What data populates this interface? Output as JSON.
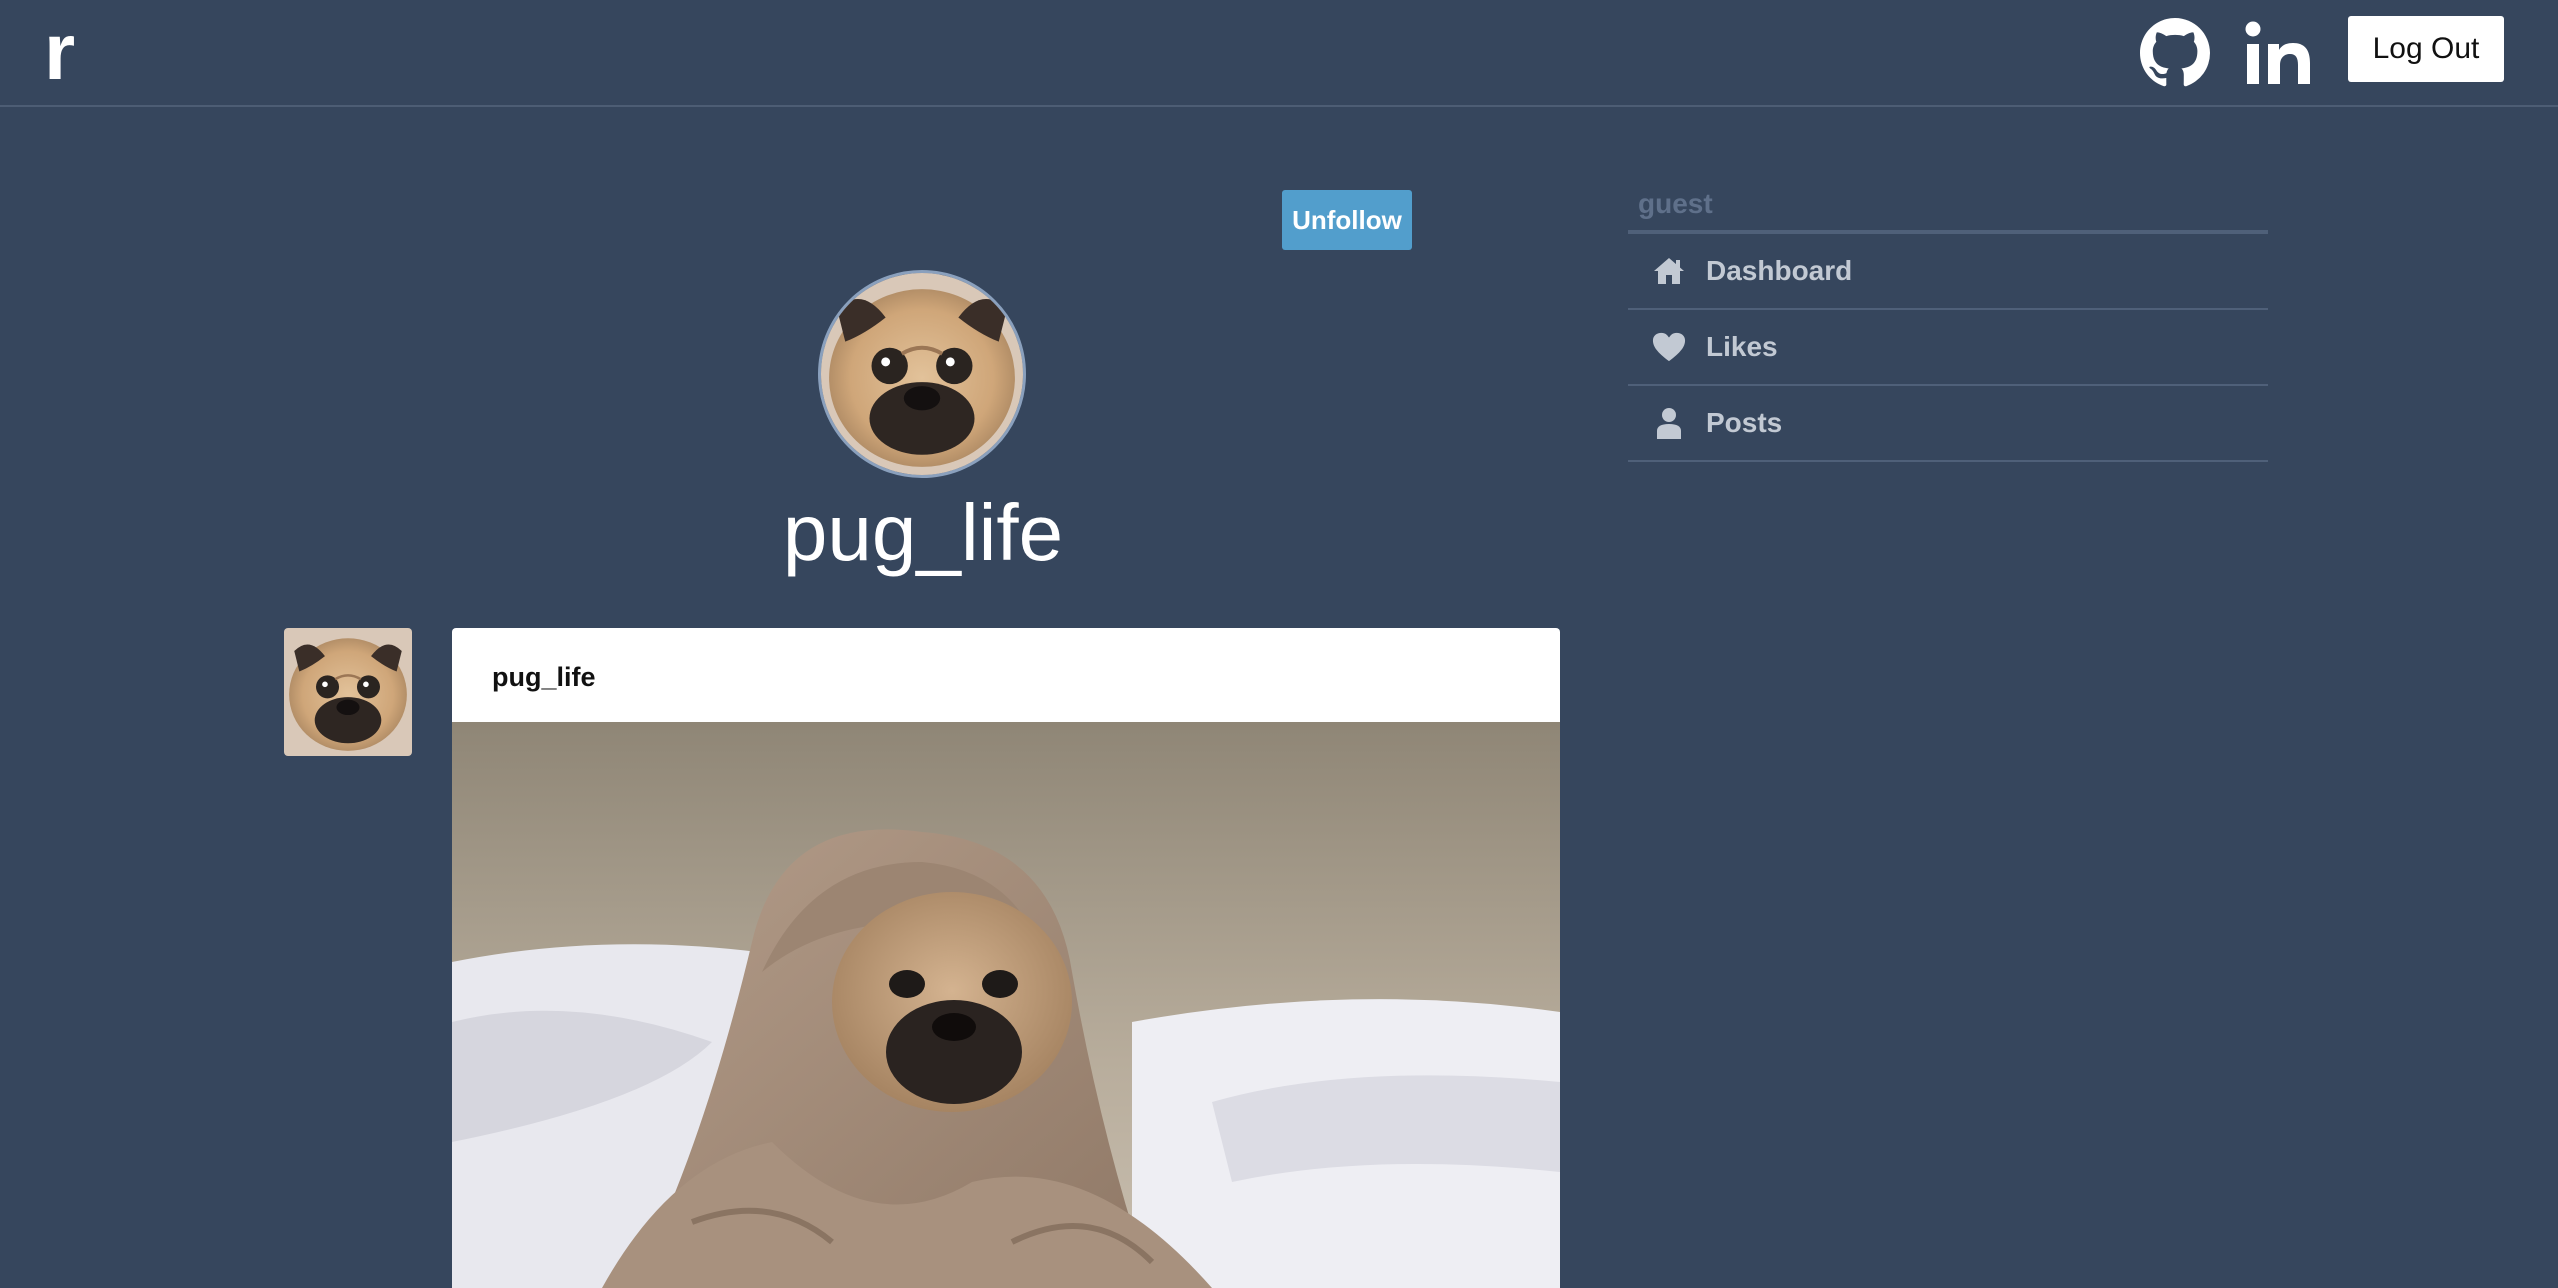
{
  "header": {
    "logo": "r",
    "github_icon": "github-icon",
    "linkedin_icon": "linkedin-icon",
    "logout_label": "Log Out"
  },
  "profile": {
    "follow_button_label": "Unfollow",
    "username": "pug_life",
    "avatar_icon": "pug-avatar"
  },
  "post": {
    "author": "pug_life",
    "image": "pug-in-blanket-photo"
  },
  "sidebar": {
    "heading": "guest",
    "items": [
      {
        "label": "Dashboard",
        "icon": "home-icon"
      },
      {
        "label": "Likes",
        "icon": "heart-icon"
      },
      {
        "label": "Posts",
        "icon": "person-icon"
      }
    ]
  },
  "colors": {
    "background": "#36465d",
    "accent": "#529ecc"
  }
}
